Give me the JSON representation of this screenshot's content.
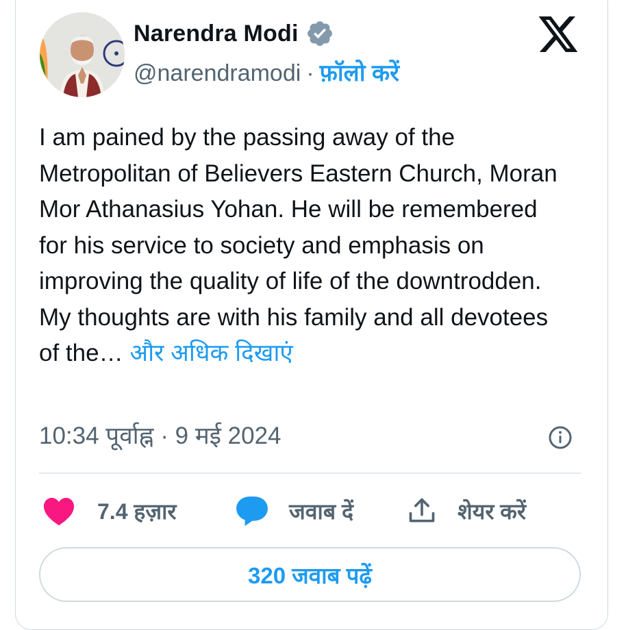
{
  "author": {
    "name": "Narendra Modi",
    "handle": "@narendramodi",
    "separator": "·",
    "follow_label": "फ़ॉलो करें",
    "verified_icon": "verified-badge-icon",
    "avatar_icon": "profile-photo"
  },
  "brand": {
    "logo_icon": "x-logo-icon"
  },
  "tweet": {
    "text": "I am pained by the passing away of the Metropolitan of Believers Eastern Church, Moran Mor Athanasius Yohan. He will be remembered for his service to society and emphasis on improving the quality of life of the downtrodden. My thoughts are with his family and all devotees of the…",
    "show_more_label": "और अधिक दिखाएं"
  },
  "meta": {
    "time": "10:34 पूर्वाह्न",
    "separator": "·",
    "date": "9 मई 2024",
    "info_icon": "info-icon"
  },
  "actions": {
    "like_count": "7.4 हज़ार",
    "reply_label": "जवाब दें",
    "share_label": "शेयर करें",
    "like_icon": "heart-icon",
    "reply_icon": "speech-bubble-icon",
    "share_icon": "share-upload-icon"
  },
  "read_replies_label": "320 जवाब पढ़ें",
  "colors": {
    "accent": "#1d9bf0",
    "heart": "#f91880",
    "text": "#0f1419",
    "secondary": "#536471",
    "border": "#cfd9de"
  }
}
